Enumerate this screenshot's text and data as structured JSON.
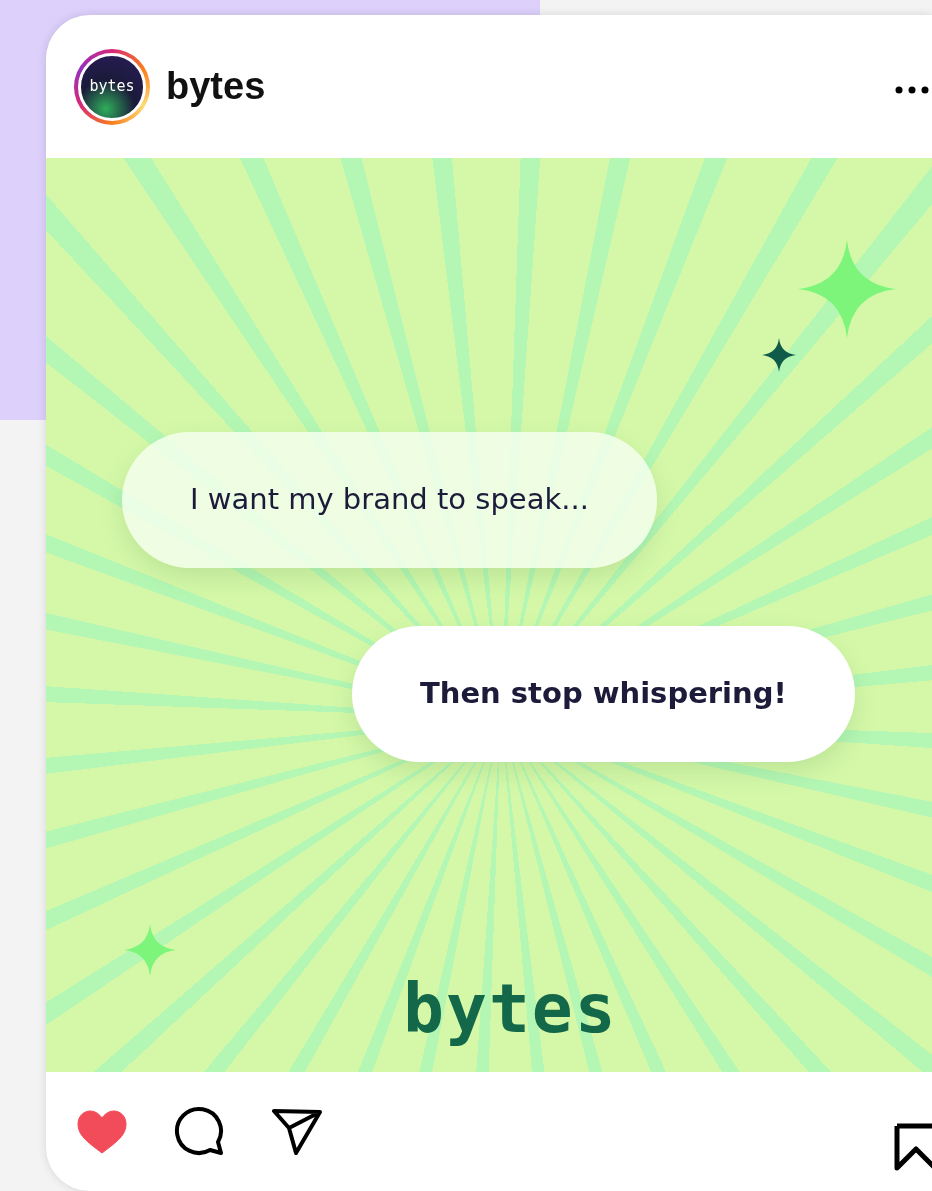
{
  "post": {
    "account": {
      "avatar_text": "bytes",
      "username": "bytes"
    },
    "image": {
      "bubbles": [
        {
          "text": "I want my brand to speak...",
          "kind": "question"
        },
        {
          "text": "Then stop whispering!",
          "kind": "answer"
        }
      ],
      "logo": "bytes"
    },
    "actions": {
      "liked": true
    }
  }
}
